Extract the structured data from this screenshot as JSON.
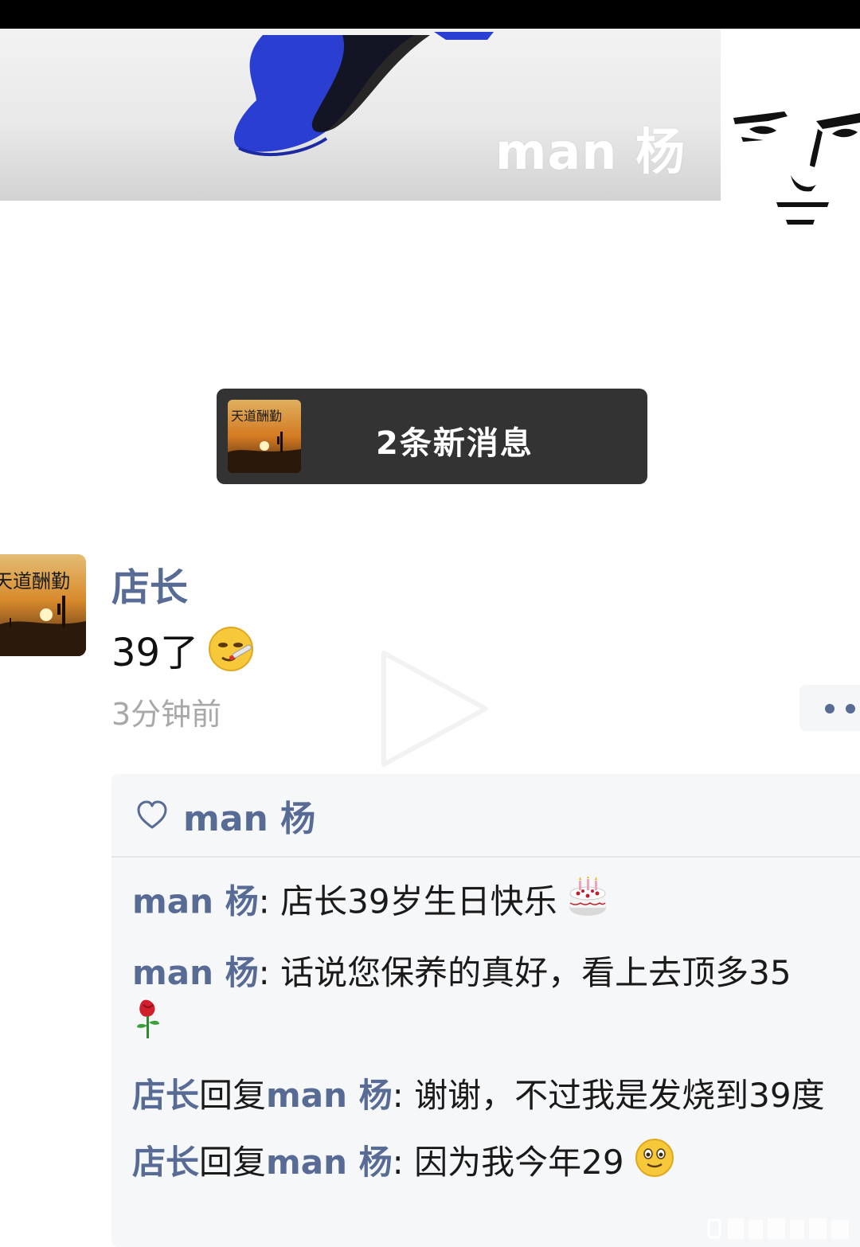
{
  "cover": {
    "name": "man 杨"
  },
  "new_messages": {
    "text": "2条新消息"
  },
  "post": {
    "author": "店长",
    "text": "39了",
    "time": "3分钟前"
  },
  "likes": {
    "names": "man 杨"
  },
  "comments": [
    {
      "from": "man 杨",
      "text": ": 店长39岁生日快乐"
    },
    {
      "from": "man 杨",
      "text": ": 话说您保养的真好，看上去顶多35"
    },
    {
      "from": "店长",
      "reply_word": "回复",
      "to": "man 杨",
      "text": ": 谢谢，不过我是发烧到39度"
    },
    {
      "from": "店长",
      "reply_word": "回复",
      "to": "man 杨",
      "text": ": 因为我今年29"
    }
  ],
  "colors": {
    "link": "#576b95",
    "timestamp": "#a8a8a8",
    "toast_bg": "#333333",
    "comment_bg": "#f6f7f9"
  },
  "icons": {
    "like": "heart-icon",
    "more": "more-dots-icon",
    "post_emoji": "sick-face-thermometer-emoji",
    "cake": "birthday-cake-emoji",
    "rose": "rose-emoji",
    "smile": "smiling-face-emoji"
  }
}
